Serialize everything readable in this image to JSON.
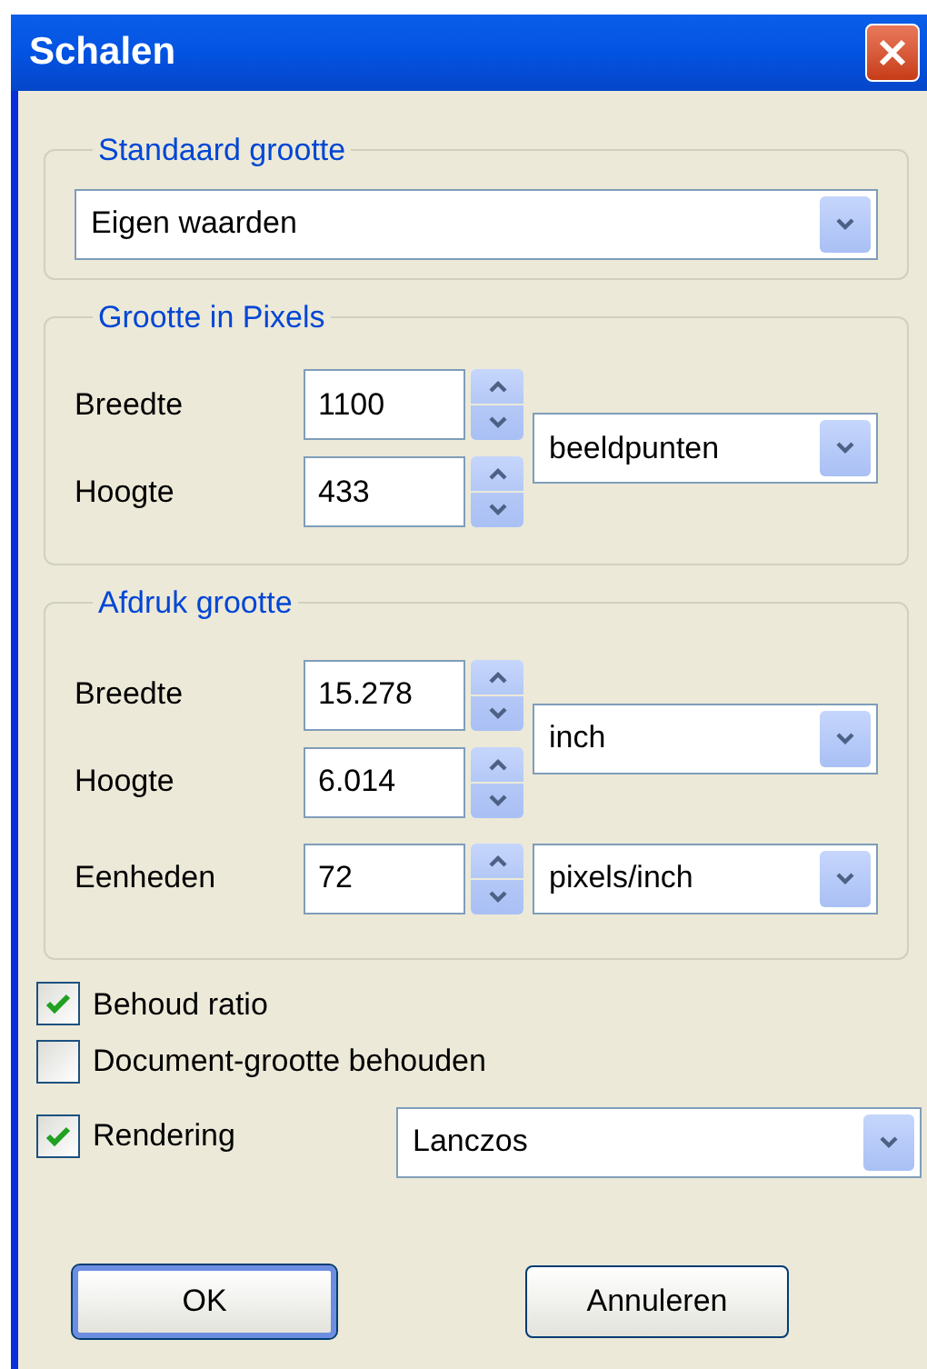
{
  "window": {
    "title": "Schalen"
  },
  "groups": [
    {
      "kind": "preset",
      "title": "Standaard grootte",
      "select": "Eigen waarden"
    },
    {
      "kind": "dimensions",
      "title": "Grootte in Pixels",
      "fields": [
        {
          "label": "Breedte",
          "value": "1100"
        },
        {
          "label": "Hoogte",
          "value": "433"
        }
      ],
      "unit": "beeldpunten"
    },
    {
      "kind": "dimensions",
      "title": "Afdruk grootte",
      "fields": [
        {
          "label": "Breedte",
          "value": "15.278"
        },
        {
          "label": "Hoogte",
          "value": "6.014"
        }
      ],
      "unit": "inch",
      "resolution": {
        "label": "Eenheden",
        "value": "72",
        "unit": "pixels/inch"
      }
    }
  ],
  "options": [
    {
      "label": "Behoud ratio",
      "checked": true
    },
    {
      "label": "Document-grootte behouden",
      "checked": false
    },
    {
      "label": "Rendering",
      "checked": true,
      "select": "Lanczos"
    }
  ],
  "buttons": [
    {
      "label": "OK",
      "default": true
    },
    {
      "label": "Annuleren",
      "default": false
    }
  ]
}
